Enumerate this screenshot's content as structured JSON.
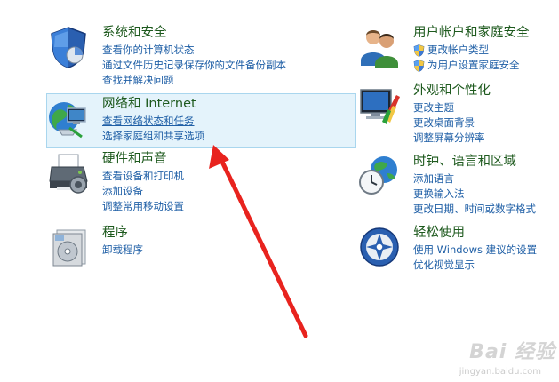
{
  "categories": {
    "system_security": {
      "title": "系统和安全",
      "icon": "shield-icon",
      "links": [
        "查看你的计算机状态",
        "通过文件历史记录保存你的文件备份副本",
        "查找并解决问题"
      ]
    },
    "network_internet": {
      "title": "网络和 Internet",
      "icon": "network-globe-icon",
      "links": [
        "查看网络状态和任务",
        "选择家庭组和共享选项"
      ]
    },
    "hardware_sound": {
      "title": "硬件和声音",
      "icon": "printer-icon",
      "links": [
        "查看设备和打印机",
        "添加设备",
        "调整常用移动设置"
      ]
    },
    "programs": {
      "title": "程序",
      "icon": "programs-icon",
      "links": [
        "卸载程序"
      ]
    },
    "user_accounts": {
      "title": "用户帐户和家庭安全",
      "icon": "users-icon",
      "links": [
        "更改帐户类型",
        "为用户设置家庭安全"
      ]
    },
    "appearance": {
      "title": "外观和个性化",
      "icon": "monitor-paint-icon",
      "links": [
        "更改主题",
        "更改桌面背景",
        "调整屏幕分辨率"
      ]
    },
    "clock_region": {
      "title": "时钟、语言和区域",
      "icon": "globe-clock-icon",
      "links": [
        "添加语言",
        "更换输入法",
        "更改日期、时间或数字格式"
      ]
    },
    "ease_of_access": {
      "title": "轻松使用",
      "icon": "ease-of-access-icon",
      "links": [
        "使用 Windows 建议的设置",
        "优化视觉显示"
      ]
    }
  },
  "watermark": {
    "text": "Bai 经验",
    "url": "jingyan.baidu.com"
  },
  "colors": {
    "title_green": "#1e5a1e",
    "link_blue": "#1f5fa6",
    "highlight_bg": "#e4f3fb",
    "arrow_red": "#e8231e"
  }
}
